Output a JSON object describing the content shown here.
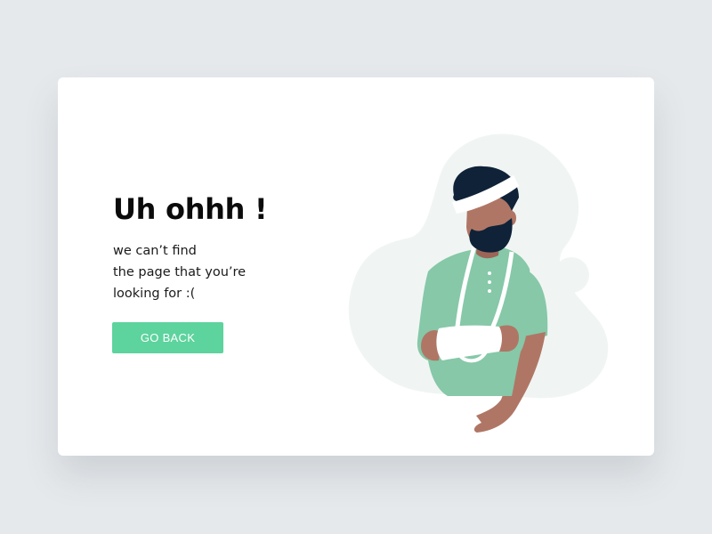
{
  "error_card": {
    "headline": "Uh ohhh !",
    "message_lines": [
      "we can’t find",
      "the page that you’re",
      "looking for :("
    ],
    "button_label": "GO BACK"
  },
  "illustration": {
    "subject": "injured man with bandaged head and arm in sling",
    "colors": {
      "blob": "#f0f5f3",
      "shirt": "#86c8a8",
      "skin": "#b07665",
      "hair": "#0f2238",
      "bandage": "#ffffff",
      "button_accent": "#5dd39e"
    }
  }
}
